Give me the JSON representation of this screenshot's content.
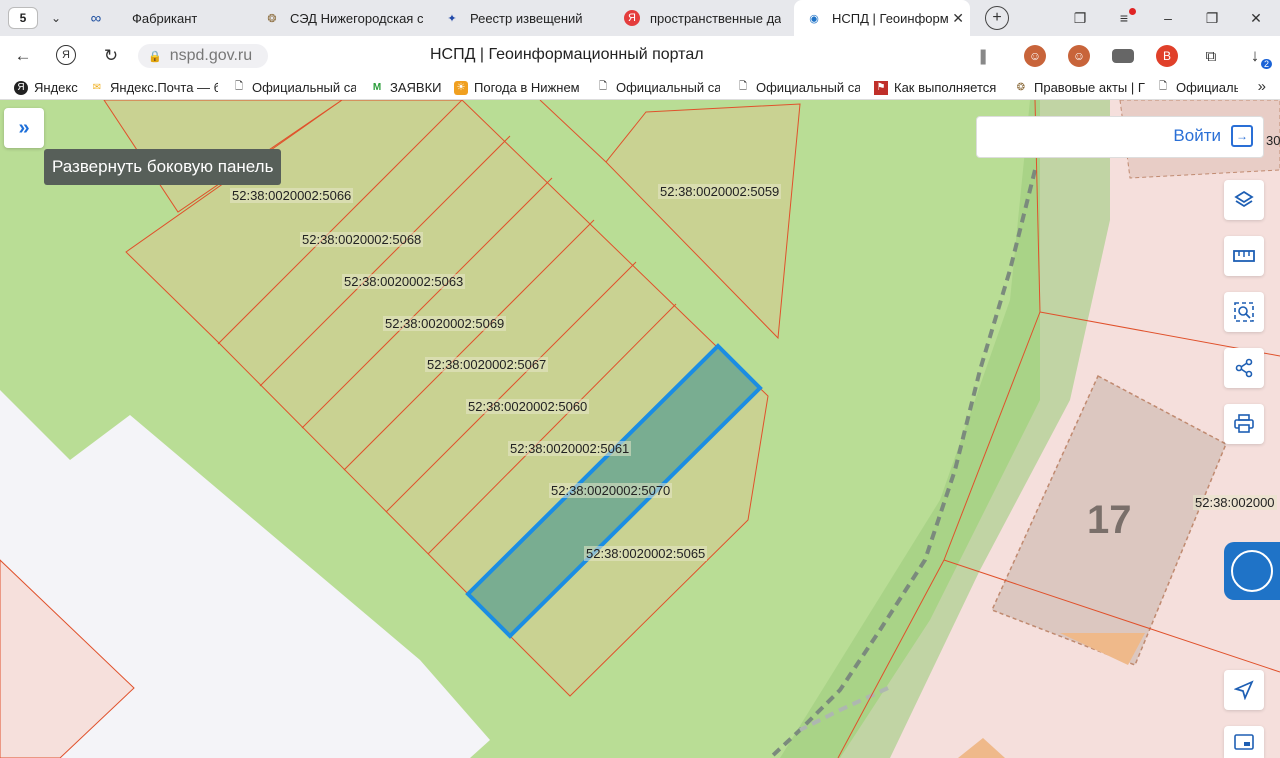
{
  "browser": {
    "tab_counter": "5",
    "tabs": [
      {
        "label": "Фабрикант",
        "favicon": "infinity-icon"
      },
      {
        "label": "СЭД Нижегородская с",
        "favicon": "seal-icon"
      },
      {
        "label": "Реестр извещений",
        "favicon": "eagle-icon"
      },
      {
        "label": "пространственные да",
        "favicon": "yandex-icon"
      },
      {
        "label": "НСПД | Геоинформ",
        "favicon": "nspd-icon",
        "active": true
      }
    ],
    "url": "nspd.gov.ru",
    "page_title": "НСПД | Геоинформационный портал",
    "downloads_badge": "2",
    "profile_letter": "В"
  },
  "bookmarks": [
    {
      "label": "Яндекс",
      "icon": "yandex-icon"
    },
    {
      "label": "Яндекс.Почта — б",
      "icon": "mail-icon"
    },
    {
      "label": "Официальный са",
      "icon": "page-icon"
    },
    {
      "label": "ЗАЯВКИ",
      "icon": "m-icon"
    },
    {
      "label": "Погода в Нижнем",
      "icon": "weather-icon"
    },
    {
      "label": "Официальный са",
      "icon": "page-icon"
    },
    {
      "label": "Официальный са",
      "icon": "page-icon"
    },
    {
      "label": "Как выполняется",
      "icon": "flag-icon"
    },
    {
      "label": "Правовые акты | Г",
      "icon": "seal-icon"
    },
    {
      "label": "Официальн",
      "icon": "page-icon"
    }
  ],
  "map": {
    "sidebar_tooltip": "Развернуть боковую панель",
    "login_label": "Войти",
    "edge_number": "30",
    "building_number": "17",
    "parcels": [
      "52:38:0020002:5066",
      "52:38:0020002:5068",
      "52:38:0020002:5063",
      "52:38:0020002:5069",
      "52:38:0020002:5067",
      "52:38:0020002:5060",
      "52:38:0020002:5061",
      "52:38:0020002:5070",
      "52:38:0020002:5065",
      "52:38:0020002:5059",
      "52:38:002000"
    ],
    "colors": {
      "land": "#b9dd95",
      "parcel_fill": "#c9d292",
      "parcel_border": "#e0512b",
      "selected_fill": "#6ba790",
      "selected_border": "#1b8de3",
      "urban": "#f5dfdc",
      "water": "#f4f4f8"
    }
  },
  "tools": [
    "layers-icon",
    "ruler-icon",
    "search-area-icon",
    "share-icon",
    "print-icon",
    "assistant-icon",
    "locate-icon",
    "screen-icon"
  ]
}
